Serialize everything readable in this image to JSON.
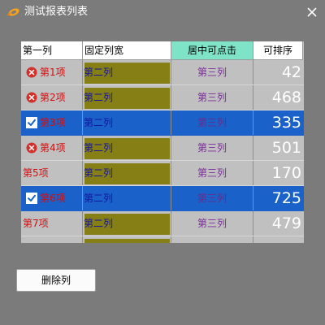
{
  "window": {
    "title": "测试报表列表",
    "close_glyph": "✕"
  },
  "grid": {
    "columns": [
      "第一列",
      "固定列宽",
      "居中可点击",
      "可排序"
    ],
    "rows": [
      {
        "icon": "error-icon",
        "col1": "第1项",
        "col2": "第二列",
        "col3": "第三列",
        "col4": "42",
        "selected": false
      },
      {
        "icon": "error-icon",
        "col1": "第2项",
        "col2": "第二列",
        "col3": "第三列",
        "col4": "468",
        "selected": false
      },
      {
        "icon": "checkbox-checked-icon",
        "col1": "第3项",
        "col2": "第二列",
        "col3": "第三列",
        "col4": "335",
        "selected": true
      },
      {
        "icon": "error-icon",
        "col1": "第4项",
        "col2": "第二列",
        "col3": "第三列",
        "col4": "501",
        "selected": false
      },
      {
        "icon": "",
        "col1": "第5项",
        "col2": "第二列",
        "col3": "第三列",
        "col4": "170",
        "selected": false
      },
      {
        "icon": "checkbox-checked-icon",
        "col1": "第6项",
        "col2": "第二列",
        "col3": "第三列",
        "col4": "725",
        "selected": true
      },
      {
        "icon": "",
        "col1": "第7项",
        "col2": "第二列",
        "col3": "第三列",
        "col4": "479",
        "selected": false
      },
      {
        "icon": "",
        "col1": "",
        "col2": "",
        "col3": "",
        "col4": "",
        "selected": false
      }
    ]
  },
  "actions": {
    "delete_column_label": "删除列"
  },
  "colors": {
    "window_bg": "#7b7b7b",
    "header_bg": "#ffffff",
    "header_highlight": "#7fe3c7",
    "selection": "#1a62c9",
    "col2_fill": "#857f15",
    "col1_text": "#d40d0d",
    "col2_text": "#1414a0",
    "col3_text": "#7b2b9b"
  }
}
